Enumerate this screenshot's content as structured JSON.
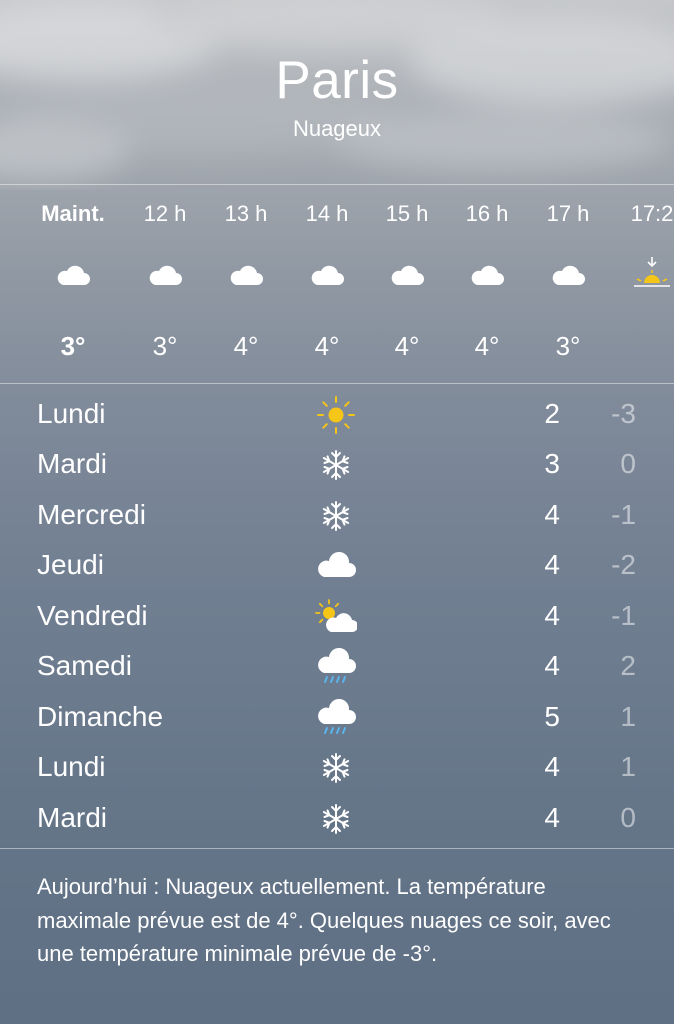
{
  "header": {
    "city": "Paris",
    "condition": "Nuageux"
  },
  "hourly": [
    {
      "time": "Maint.",
      "icon": "cloud-icon",
      "temp": "3°"
    },
    {
      "time": "12 h",
      "icon": "cloud-icon",
      "temp": "3°"
    },
    {
      "time": "13 h",
      "icon": "cloud-icon",
      "temp": "4°"
    },
    {
      "time": "14 h",
      "icon": "cloud-icon",
      "temp": "4°"
    },
    {
      "time": "15 h",
      "icon": "cloud-icon",
      "temp": "4°"
    },
    {
      "time": "16 h",
      "icon": "cloud-icon",
      "temp": "4°"
    },
    {
      "time": "17 h",
      "icon": "cloud-icon",
      "temp": "3°"
    },
    {
      "time": "17:2",
      "icon": "sunset-icon",
      "temp": ""
    }
  ],
  "daily": [
    {
      "day": "Lundi",
      "icon": "sun-icon",
      "high": "2",
      "low": "-3"
    },
    {
      "day": "Mardi",
      "icon": "snowflake-icon",
      "high": "3",
      "low": "0"
    },
    {
      "day": "Mercredi",
      "icon": "snowflake-icon",
      "high": "4",
      "low": "-1"
    },
    {
      "day": "Jeudi",
      "icon": "cloud-icon",
      "high": "4",
      "low": "-2"
    },
    {
      "day": "Vendredi",
      "icon": "partly-cloudy-icon",
      "high": "4",
      "low": "-1"
    },
    {
      "day": "Samedi",
      "icon": "rain-icon",
      "high": "4",
      "low": "2"
    },
    {
      "day": "Dimanche",
      "icon": "rain-icon",
      "high": "5",
      "low": "1"
    },
    {
      "day": "Lundi",
      "icon": "snowflake-icon",
      "high": "4",
      "low": "1"
    },
    {
      "day": "Mardi",
      "icon": "snowflake-icon",
      "high": "4",
      "low": "0"
    }
  ],
  "summary": "Aujourd’hui : Nuageux actuellement. La température maximale prévue est de 4°. Quelques nuages ce soir, avec une température minimale prévue de -3°.",
  "colors": {
    "sun": "#f5c518",
    "rain": "#5bb5ee",
    "text": "#ffffff"
  }
}
